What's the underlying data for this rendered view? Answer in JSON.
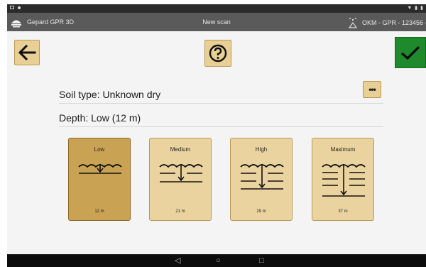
{
  "app": {
    "title": "Gepard GPR 3D",
    "screen_title": "New scan",
    "device": "OKM - GPR - 123456 -"
  },
  "soil": {
    "label": "Soil type: Unknown dry"
  },
  "depth": {
    "label": "Depth: Low (12 m)"
  },
  "more_label": "•••",
  "depth_options": [
    {
      "label": "Low",
      "distance": "12 m",
      "selected": true
    },
    {
      "label": "Medium",
      "distance": "21 m",
      "selected": false
    },
    {
      "label": "High",
      "distance": "29 m",
      "selected": false
    },
    {
      "label": "Maximum",
      "distance": "37 m",
      "selected": false
    }
  ],
  "icons": {
    "back": "arrow-left-icon",
    "help": "question-mark-icon",
    "confirm": "checkmark-icon",
    "logo": "gepard-logo-icon",
    "device": "radar-signal-icon"
  },
  "colors": {
    "button_fill": "#e8cf94",
    "card_fill": "#ebd3a0",
    "card_selected": "#c9a254",
    "confirm_green": "#1e8a2c",
    "appbar": "#5a5a5a"
  }
}
